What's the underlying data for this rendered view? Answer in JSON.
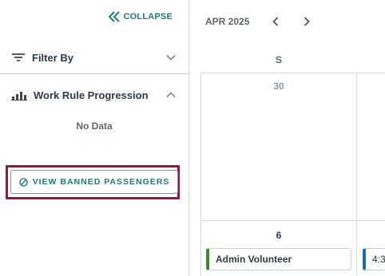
{
  "sidebar": {
    "collapse_label": "COLLAPSE",
    "filter": {
      "label": "Filter By"
    },
    "work_rule": {
      "label": "Work Rule Progression",
      "empty_text": "No Data"
    },
    "banned_button_label": "VIEW BANNED PASSENGERS"
  },
  "calendar": {
    "month_label": "APR 2025",
    "day_of_week": "S",
    "days": [
      {
        "number": "30",
        "muted": true
      },
      {
        "number": "6",
        "muted": false
      }
    ],
    "events": [
      {
        "label": "Admin Volunteer",
        "color": "#3a8a3a"
      },
      {
        "label": "4:3",
        "color": "#1f6f9e"
      }
    ]
  },
  "colors": {
    "accent": "#1e7b7b",
    "highlight_border": "#8c1a44"
  }
}
